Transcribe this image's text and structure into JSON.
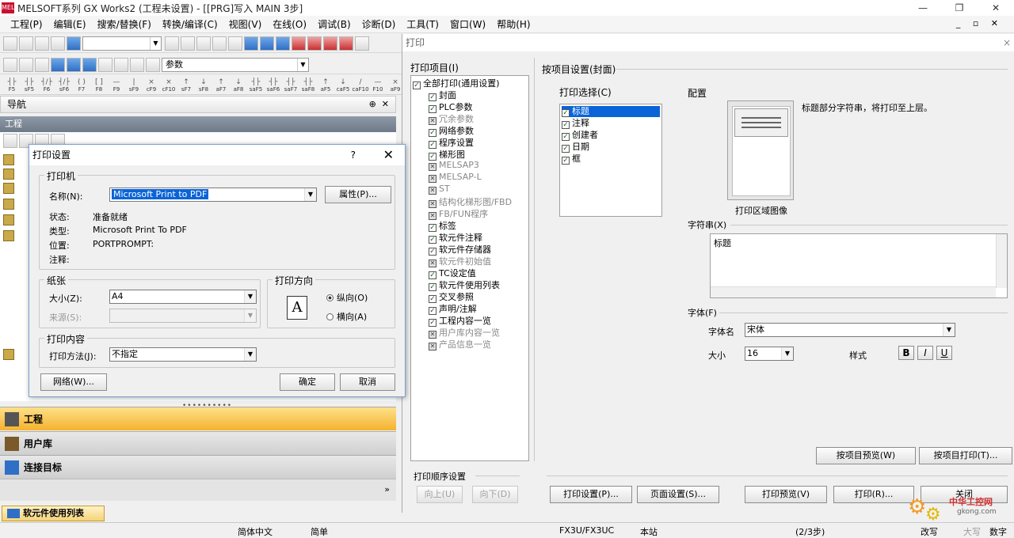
{
  "window": {
    "title": "MELSOFT系列 GX Works2 (工程未设置) - [[PRG]写入 MAIN 3步]",
    "app_icon": "MEL",
    "min": "—",
    "restore": "❐",
    "close": "✕"
  },
  "menu": {
    "items": [
      "工程(P)",
      "编辑(E)",
      "搜索/替换(F)",
      "转换/编译(C)",
      "视图(V)",
      "在线(O)",
      "调试(B)",
      "诊断(D)",
      "工具(T)",
      "窗口(W)",
      "帮助(H)"
    ],
    "right_controls": "_ ▫ ✕"
  },
  "toolbar": {
    "param_combo": "参数"
  },
  "navigation": {
    "title": "导航",
    "pin": "⊕",
    "close": "✕",
    "section": "工程",
    "more": "»"
  },
  "nav_buttons": [
    {
      "label": "工程"
    },
    {
      "label": "用户库"
    },
    {
      "label": "连接目标"
    }
  ],
  "doc_tab": {
    "label": "软元件使用列表"
  },
  "statusbar": {
    "language": "简体中文",
    "mode": "简单",
    "cpu": "FX3U/FX3UC",
    "station": "本站",
    "steps": "(2/3步)",
    "ovr": "改写",
    "caps": "大写",
    "num": "数字"
  },
  "print_setup_dialog": {
    "title": "打印设置",
    "help": "?",
    "close": "✕",
    "printer_group": "打印机",
    "name_label": "名称(N):",
    "name_value": "Microsoft Print to PDF",
    "properties_button": "属性(P)...",
    "status_label": "状态:",
    "status_value": "准备就绪",
    "type_label": "类型:",
    "type_value": "Microsoft Print To PDF",
    "location_label": "位置:",
    "location_value": "PORTPROMPT:",
    "comment_label": "注释:",
    "paper_group": "纸张",
    "size_label": "大小(Z):",
    "size_value": "A4",
    "source_label": "来源(S):",
    "orientation_group": "打印方向",
    "portrait": "纵向(O)",
    "landscape": "横向(A)",
    "orientation_icon": "A",
    "content_group": "打印内容",
    "method_label": "打印方法(J):",
    "method_value": "不指定",
    "network_button": "网络(W)...",
    "ok_button": "确定",
    "cancel_button": "取消"
  },
  "print_window": {
    "title": "打印",
    "close": "×",
    "items_label": "打印项目(I)",
    "items": [
      {
        "label": "全部打印(通用设置)",
        "state": "on",
        "level": 0
      },
      {
        "label": "封面",
        "state": "on",
        "level": 1
      },
      {
        "label": "PLC参数",
        "state": "on",
        "level": 1
      },
      {
        "label": "冗余参数",
        "state": "x",
        "level": 1
      },
      {
        "label": "网络参数",
        "state": "on",
        "level": 1
      },
      {
        "label": "程序设置",
        "state": "on",
        "level": 1
      },
      {
        "label": "梯形图",
        "state": "on",
        "level": 1
      },
      {
        "label": "MELSAP3",
        "state": "x",
        "level": 1
      },
      {
        "label": "MELSAP-L",
        "state": "x",
        "level": 1
      },
      {
        "label": "ST",
        "state": "x",
        "level": 1
      },
      {
        "label": "结构化梯形图/FBD",
        "state": "x",
        "level": 1
      },
      {
        "label": "FB/FUN程序",
        "state": "x",
        "level": 1
      },
      {
        "label": "标签",
        "state": "on",
        "level": 1
      },
      {
        "label": "软元件注释",
        "state": "on",
        "level": 1
      },
      {
        "label": "软元件存储器",
        "state": "on",
        "level": 1
      },
      {
        "label": "软元件初始值",
        "state": "x",
        "level": 1
      },
      {
        "label": "TC设定值",
        "state": "on",
        "level": 1
      },
      {
        "label": "软元件使用列表",
        "state": "on",
        "level": 1
      },
      {
        "label": "交叉参照",
        "state": "on",
        "level": 1
      },
      {
        "label": "声明/注解",
        "state": "on",
        "level": 1
      },
      {
        "label": "工程内容一览",
        "state": "on",
        "level": 1
      },
      {
        "label": "用户库内容一览",
        "state": "x",
        "level": 1
      },
      {
        "label": "产品信息一览",
        "state": "x",
        "level": 1
      }
    ],
    "item_settings_label": "按项目设置(封面)",
    "select_label": "打印选择(C)",
    "select_items": [
      {
        "label": "标题",
        "selected": true
      },
      {
        "label": "注释",
        "selected": false
      },
      {
        "label": "创建者",
        "selected": false
      },
      {
        "label": "日期",
        "selected": false
      },
      {
        "label": "框",
        "selected": false
      }
    ],
    "layout_label": "配置",
    "layout_desc": "标题部分字符串，将打印至上层。",
    "print_area_label": "打印区域图像",
    "string_label": "字符串(X)",
    "string_value": "标题",
    "font_label": "字体(F)",
    "font_name_label": "字体名",
    "font_name_value": "宋体",
    "font_size_label": "大小",
    "font_size_value": "16",
    "style_label": "样式",
    "bold": "B",
    "italic": "I",
    "underline": "U",
    "item_preview_button": "按项目预览(W)",
    "item_print_button": "按项目打印(T)...",
    "order_label": "打印顺序设置",
    "up_button": "向上(U)",
    "down_button": "向下(D)",
    "print_setup_button": "打印设置(P)...",
    "page_setup_button": "页面设置(S)...",
    "print_preview_button": "打印预览(V)",
    "print_button": "打印(R)...",
    "close_button": "关闭"
  },
  "watermark": {
    "text": "中华工控网",
    "url": "gkong.com"
  }
}
